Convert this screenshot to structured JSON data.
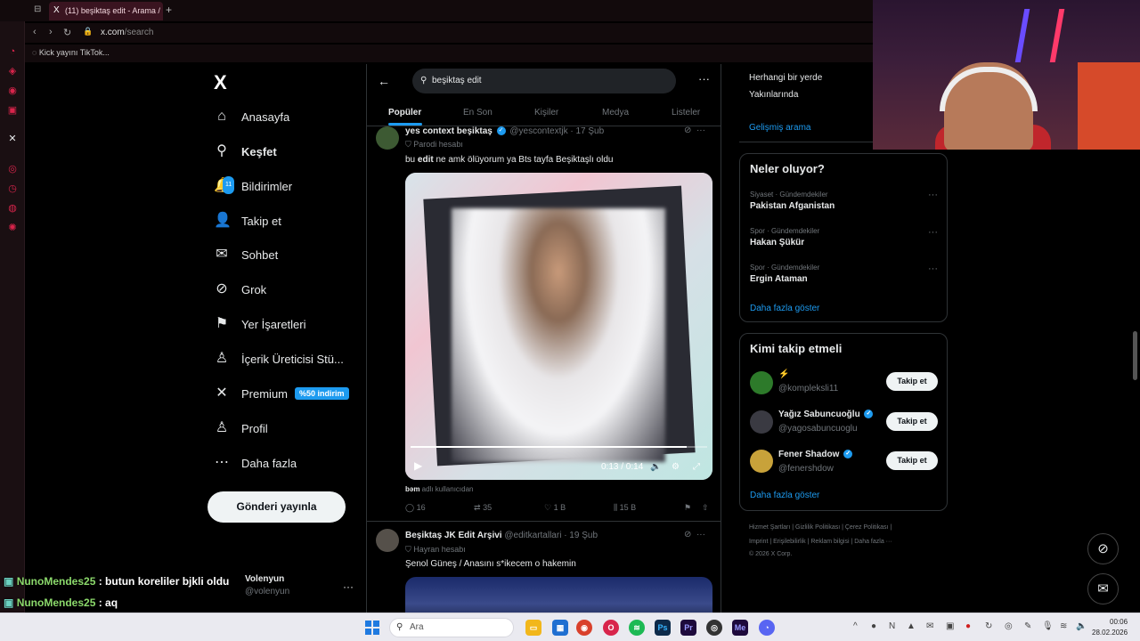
{
  "browser": {
    "tab_title": "(11) beşiktaş edit - Arama /",
    "tab_x_icon": "X",
    "new_tab": "+",
    "url_domain": "x.com",
    "url_path": "/search",
    "bookmark": "Kick yayını TikTok..."
  },
  "nav": {
    "logo": "X",
    "items": [
      {
        "label": "Anasayfa",
        "icon": "home-icon",
        "glyph": "⌂"
      },
      {
        "label": "Keşfet",
        "icon": "search-icon",
        "glyph": "⚲"
      },
      {
        "label": "Bildirimler",
        "icon": "bell-icon",
        "glyph": "🔔",
        "badge": "11"
      },
      {
        "label": "Takip et",
        "icon": "add-person-icon",
        "glyph": "👤"
      },
      {
        "label": "Sohbet",
        "icon": "mail-icon",
        "glyph": "✉"
      },
      {
        "label": "Grok",
        "icon": "grok-icon",
        "glyph": "⊘"
      },
      {
        "label": "Yer İşaretleri",
        "icon": "bookmark-icon",
        "glyph": "⚑"
      },
      {
        "label": "İçerik Üreticisi Stü...",
        "icon": "creator-icon",
        "glyph": "♙"
      },
      {
        "label": "Premium",
        "icon": "x-icon",
        "glyph": "✕",
        "discount": "%50 indirim"
      },
      {
        "label": "Profil",
        "icon": "profile-icon",
        "glyph": "♙"
      },
      {
        "label": "Daha fazla",
        "icon": "more-circle-icon",
        "glyph": "⋯"
      }
    ],
    "post_button": "Gönderi yayınla",
    "me_name": "Volenyun",
    "me_handle": "@volenyun",
    "me_more": "···"
  },
  "chat": [
    {
      "user": "NunoMendes25",
      "text": " : butun koreliler bjkli oldu"
    },
    {
      "user": "NunoMendes25",
      "text": " : aq"
    }
  ],
  "search": {
    "query": "beşiktaş edit",
    "tabs": [
      "Popüler",
      "En Son",
      "Kişiler",
      "Medya",
      "Listeler"
    ],
    "active_tab": "Popüler"
  },
  "tweets": [
    {
      "name": "yes context beşiktaş",
      "handle": "@yescontextjk",
      "date": "· 17 Şub",
      "sub": "Parodi hesabı",
      "text_pre": "bu ",
      "text_bold": "edit",
      "text_post": " ne amk ölüyorum ya Bts tayfa Beşiktaşlı oldu",
      "video_time": "0:13 / 0:14",
      "video_progress": 0.93,
      "from_user": "bəm",
      "from_suffix": " adlı kullanıcıdan",
      "replies": "16",
      "retweets": "35",
      "likes": "1 B",
      "views": "15 B"
    },
    {
      "name": "Beşiktaş JK Edit Arşivi",
      "handle": "@editkartallari",
      "date": "· 19 Şub",
      "sub": "Hayran hesabı",
      "text": "Şenol Güneş / Anasını s*ikecem o hakemin"
    }
  ],
  "right": {
    "filters": [
      "Herhangi bir yerde",
      "Yakınlarında"
    ],
    "advanced": "Gelişmiş arama",
    "trends_title": "Neler oluyor?",
    "trends": [
      {
        "cat": "Siyaset · Gündemdekiler",
        "name": "Pakistan Afganistan"
      },
      {
        "cat": "Spor · Gündemdekiler",
        "name": "Hakan Şükür"
      },
      {
        "cat": "Spor · Gündemdekiler",
        "name": "Ergin Ataman"
      }
    ],
    "show_more": "Daha fazla göster",
    "wtf_title": "Kimi takip etmeli",
    "wtf": [
      {
        "name": "",
        "handle": "@kompleksli11",
        "follow": "Takip et",
        "verified": false
      },
      {
        "name": "Yağız Sabuncuoğlu",
        "handle": "@yagosabuncuoglu",
        "follow": "Takip et",
        "verified": true
      },
      {
        "name": "Fener Shadow",
        "handle": "@fenershdow",
        "follow": "Takip et",
        "verified": true
      }
    ],
    "footer1": "Hizmet Şartları  |  Gizlilik Politikası  |  Çerez Politikası  |",
    "footer2": "Imprint  |  Erişilebilirlik  |  Reklam bilgisi  |  Daha fazla ···",
    "footer3": "© 2026 X Corp."
  },
  "taskbar": {
    "search_placeholder": "Ara",
    "time": "00:06",
    "date": "28.02.2026"
  },
  "colors": {
    "accent": "#1d9bf0",
    "opera": "#d8244b"
  }
}
